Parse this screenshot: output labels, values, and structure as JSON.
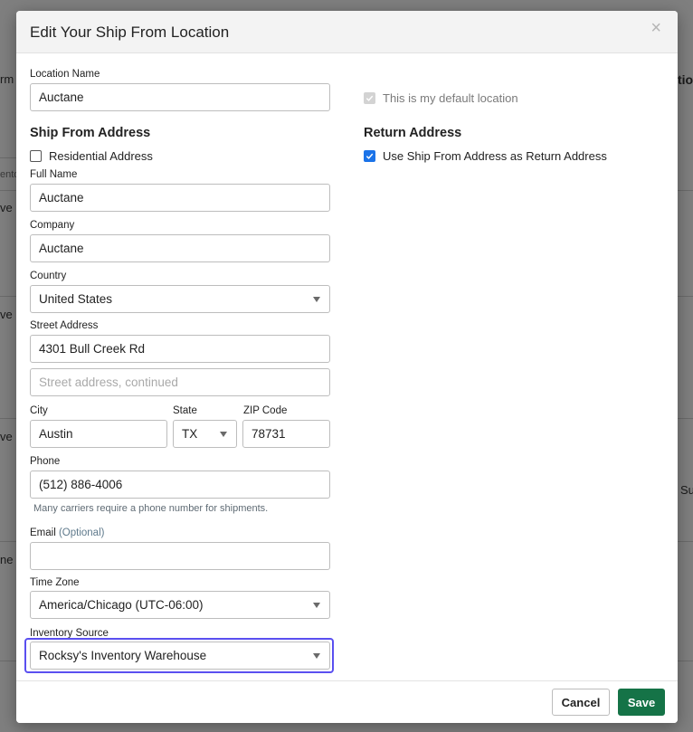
{
  "background": {
    "frag1": "rm",
    "frag2": "tio",
    "frag3": "ento",
    "frag4": "ve",
    "frag5": "ve",
    "frag6": "ve",
    "frag7": "Su",
    "frag8": "ne"
  },
  "modal": {
    "title": "Edit Your Ship From Location",
    "close_glyph": "×"
  },
  "location_name": {
    "label": "Location Name",
    "value": "Auctane"
  },
  "default_location": {
    "label": "This is my default location",
    "checked": true,
    "disabled": true
  },
  "ship_from": {
    "title": "Ship From Address",
    "residential": {
      "label": "Residential Address",
      "checked": false
    },
    "full_name": {
      "label": "Full Name",
      "value": "Auctane"
    },
    "company": {
      "label": "Company",
      "value": "Auctane"
    },
    "country": {
      "label": "Country",
      "value": "United States"
    },
    "street": {
      "label": "Street Address",
      "value": "4301 Bull Creek Rd"
    },
    "street2": {
      "placeholder": "Street address, continued"
    },
    "city": {
      "label": "City",
      "value": "Austin"
    },
    "state": {
      "label": "State",
      "value": "TX"
    },
    "zip": {
      "label": "ZIP Code",
      "value": "78731"
    },
    "phone": {
      "label": "Phone",
      "value": "(512) 886-4006",
      "help": "Many carriers require a phone number for shipments."
    },
    "email": {
      "label": "Email",
      "optional": "(Optional)",
      "value": ""
    },
    "timezone": {
      "label": "Time Zone",
      "value": "America/Chicago (UTC-06:00)"
    },
    "inventory": {
      "label": "Inventory Source",
      "value": "Rocksy's Inventory Warehouse"
    }
  },
  "return_address": {
    "title": "Return Address",
    "use_ship_from": {
      "label": "Use Ship From Address as Return Address",
      "checked": true
    }
  },
  "footer": {
    "cancel_label": "Cancel",
    "save_label": "Save"
  },
  "colors": {
    "accent": "#1b73e8",
    "save": "#157347",
    "focus": "#5a4ff0"
  }
}
